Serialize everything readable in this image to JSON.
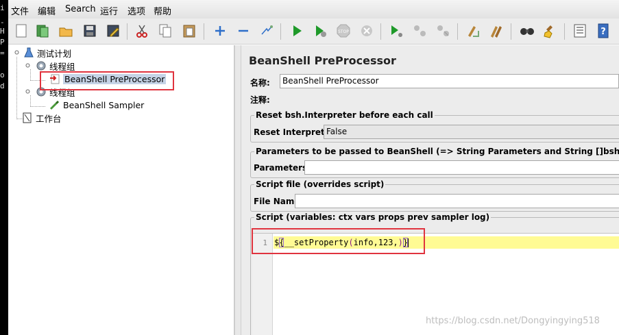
{
  "terminal_strip": [
    "i",
    "-",
    "H",
    "P",
    "=",
    "o",
    "d"
  ],
  "menu": [
    "文件",
    "编辑",
    "Search",
    "运行",
    "选项",
    "帮助"
  ],
  "toolbar": [
    "new-icon",
    "templates-icon",
    "open-icon",
    "save-icon",
    "save-as-icon",
    "cut-icon",
    "copy-icon",
    "paste-icon",
    "expand-icon",
    "collapse-icon",
    "toggle-icon",
    "start-icon",
    "start-no-pause-icon",
    "stop-icon",
    "shutdown-icon",
    "remote-start-icon",
    "remote-stop-icon",
    "remote-shutdown-icon",
    "clear-icon",
    "clear-all-icon",
    "search-icon",
    "reset-search-icon",
    "function-helper-icon",
    "help-icon"
  ],
  "tree": {
    "test_plan": "测试计划",
    "thread_group_1": "线程组",
    "preprocessor": "BeanShell PreProcessor",
    "thread_group_2": "线程组",
    "sampler": "BeanShell Sampler",
    "workbench": "工作台"
  },
  "panel": {
    "title": "BeanShell PreProcessor",
    "name_label": "名称:",
    "name_value": "BeanShell PreProcessor",
    "comment_label": "注释:",
    "comment_value": "",
    "reset_group_title": "Reset bsh.Interpreter before each call",
    "reset_label": "Reset Interpreter:",
    "reset_value": "False",
    "params_group_title": "Parameters to be passed to BeanShell (=> String Parameters and String []bsh.args)",
    "params_label": "Parameters:",
    "params_value": "",
    "file_group_title": "Script file (overrides script)",
    "file_label": "File Name:",
    "file_value": "",
    "script_group_title": "Script (variables: ctx vars props prev sampler log)"
  },
  "editor": {
    "line_number": "1",
    "code": {
      "dollar": "$",
      "open_brace": "{",
      "func": "__setProperty",
      "open_paren": "(",
      "args": "info,123,",
      "close_paren": ")",
      "close_brace": "}"
    }
  },
  "watermark": "https://blog.csdn.net/Dongyingying518",
  "colors": {
    "highlight_box": "#e0333e",
    "selection": "#c5d3e6",
    "current_line": "#fffb94",
    "paren_color": "#8a1a8a"
  }
}
